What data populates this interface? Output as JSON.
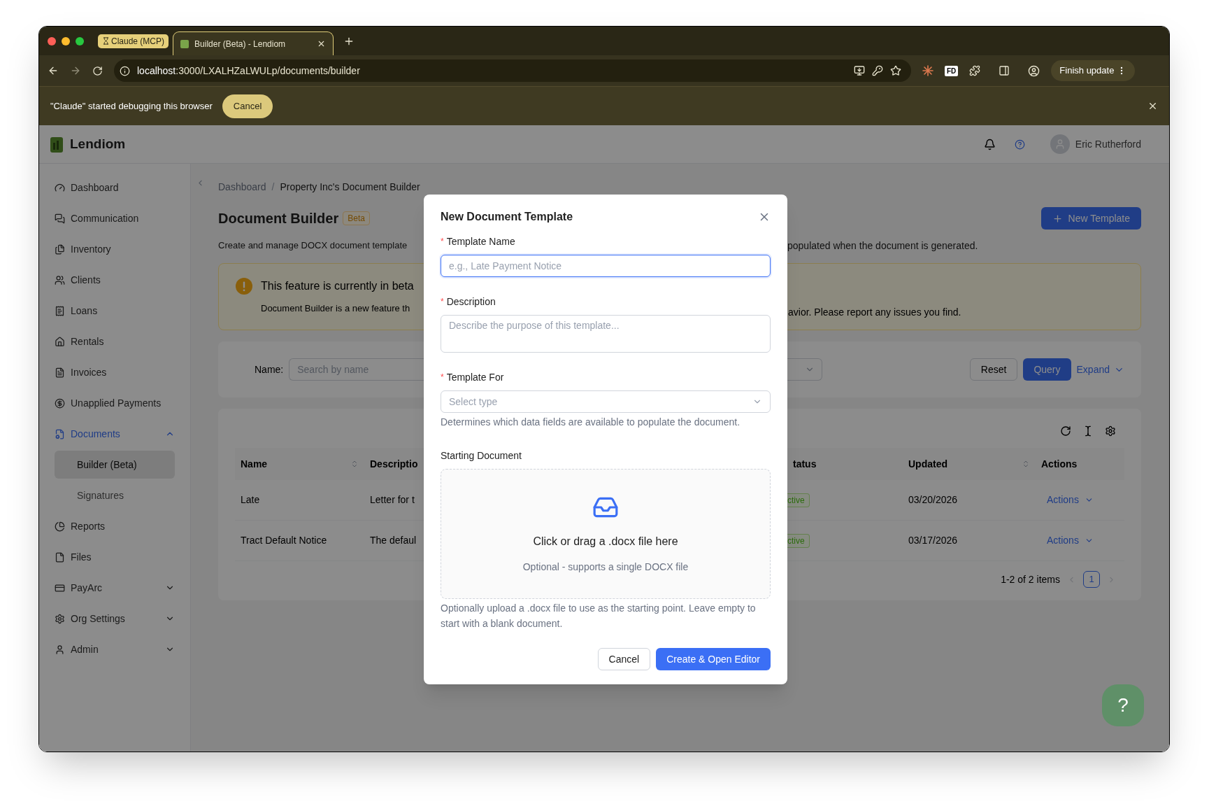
{
  "browser": {
    "tabs": [
      {
        "kind": "group",
        "label": "Claude (MCP)"
      },
      {
        "kind": "page",
        "label": "Builder (Beta) - Lendiom"
      }
    ],
    "url_host": "localhost",
    "url_path": ":3000/LXALHZaLWULp/documents/builder",
    "toolbar_badge": "FD",
    "update_button": "Finish update"
  },
  "debug_bar": {
    "message": "\"Claude\" started debugging this browser",
    "cancel": "Cancel"
  },
  "header": {
    "brand": "Lendiom",
    "user": "Eric Rutherford"
  },
  "sidebar": {
    "items": [
      {
        "label": "Dashboard",
        "selected": false
      },
      {
        "label": "Communication",
        "selected": false
      },
      {
        "label": "Inventory",
        "selected": false
      },
      {
        "label": "Clients",
        "selected": false
      },
      {
        "label": "Loans",
        "selected": false
      },
      {
        "label": "Rentals",
        "selected": false
      },
      {
        "label": "Invoices",
        "selected": false
      },
      {
        "label": "Unapplied Payments",
        "selected": false
      },
      {
        "label": "Documents",
        "selected": true,
        "expanded": true,
        "children": [
          {
            "label": "Builder (Beta)",
            "selected": true
          },
          {
            "label": "Signatures",
            "selected": false
          }
        ]
      },
      {
        "label": "Reports",
        "selected": false
      },
      {
        "label": "Files",
        "selected": false
      },
      {
        "label": "PayArc",
        "selected": false,
        "expanded": false
      },
      {
        "label": "Org Settings",
        "selected": false,
        "expanded": false
      },
      {
        "label": "Admin",
        "selected": false,
        "expanded": false
      }
    ]
  },
  "breadcrumb": [
    "Dashboard",
    "/",
    "Property Inc's Document Builder"
  ],
  "page": {
    "title": "Document Builder",
    "badge": "Beta",
    "new_button": "New Template",
    "description_left": "Create and manage DOCX document template",
    "description_right": "populated when the document is generated."
  },
  "banner": {
    "title": "This feature is currently in beta",
    "text_left": "Document Builder is a new feature th",
    "text_right": "avior. Please report any issues you find."
  },
  "filter": {
    "label": "Name:",
    "placeholder": "Search by name",
    "reset": "Reset",
    "query": "Query",
    "expand": "Expand"
  },
  "table": {
    "columns": [
      {
        "label": "Name",
        "sortable": true
      },
      {
        "label": "Descriptio"
      },
      {
        "label": "tatus",
        "sortable": false
      },
      {
        "label": "Updated",
        "sortable": true
      },
      {
        "label": "Actions",
        "sortable": false
      }
    ],
    "rows": [
      {
        "name": "Late",
        "description": "Letter for t",
        "status": "ctive",
        "updated": "03/20/2026",
        "action": "Actions"
      },
      {
        "name": "Tract Default Notice",
        "description": "The defaul",
        "status": "ctive",
        "updated": "03/17/2026",
        "action": "Actions"
      }
    ],
    "summary": "1-2 of 2 items",
    "pages": [
      {
        "label": "1",
        "selected": true
      }
    ]
  },
  "modal": {
    "title": "New Document Template",
    "fields": [
      {
        "kind": "input",
        "label": "Template Name",
        "required_mark": "*",
        "focused": true,
        "placeholder": "e.g., Late Payment Notice"
      },
      {
        "kind": "textarea",
        "label": "Description",
        "required_mark": "*",
        "focused": false,
        "placeholder": "Describe the purpose of this template..."
      },
      {
        "kind": "select",
        "label": "Template For",
        "required_mark": "*",
        "focused": false,
        "placeholder": "Select type",
        "help": "Determines which data fields are available to populate the document."
      },
      {
        "kind": "upload",
        "label": "Starting Document",
        "title": "Click or drag a .docx file here",
        "hint": "Optional - supports a single DOCX file",
        "help": "Optionally upload a .docx file to use as the starting point. Leave empty to start with a blank document."
      }
    ],
    "buttons": [
      {
        "kind": "default",
        "label": "Cancel"
      },
      {
        "kind": "primary",
        "label": "Create & Open Editor"
      }
    ]
  },
  "help_button": "?"
}
